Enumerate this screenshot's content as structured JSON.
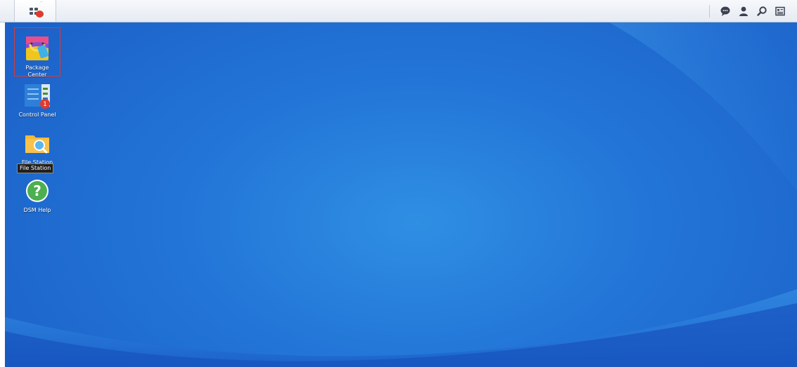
{
  "taskbar": {
    "main_menu_icon": "main-menu-icon",
    "tray_icons": [
      "chat-icon",
      "user-icon",
      "search-icon",
      "widgets-icon"
    ]
  },
  "desktop": {
    "icons": [
      {
        "label": "Package\nCenter",
        "icon": "package-center-icon"
      },
      {
        "label": "Control Panel",
        "icon": "control-panel-icon",
        "badge": "1"
      },
      {
        "label": "File Station",
        "icon": "file-station-icon"
      },
      {
        "label": "DSM Help",
        "icon": "help-icon"
      }
    ],
    "tooltip": "File Station"
  },
  "colors": {
    "desktop_blue": "#2274d6",
    "highlight_border": "#d93a36",
    "badge_red": "#e03a2e"
  }
}
